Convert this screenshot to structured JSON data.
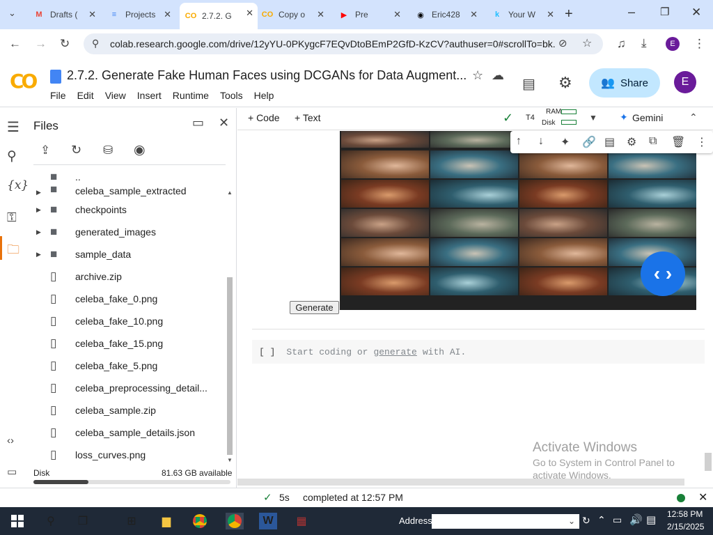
{
  "browser": {
    "tabs": [
      {
        "title": "Drafts (",
        "favicon": "gmail-icon",
        "fav_color": "#ea4335",
        "fav_glyph": "M"
      },
      {
        "title": "Projects",
        "favicon": "docs-icon",
        "fav_color": "#4285f4",
        "fav_glyph": "≡"
      },
      {
        "title": "2.7.2. G",
        "favicon": "colab-icon",
        "fav_color": "#f9ab00",
        "fav_glyph": "CO"
      },
      {
        "title": "Copy o",
        "favicon": "colab-icon",
        "fav_color": "#f9ab00",
        "fav_glyph": "CO"
      },
      {
        "title": "Pre",
        "favicon": "youtube-icon",
        "fav_color": "#ff0000",
        "fav_glyph": "▶"
      },
      {
        "title": "Eric428",
        "favicon": "github-icon",
        "fav_color": "#000000",
        "fav_glyph": "◉"
      },
      {
        "title": "Your W",
        "favicon": "kaggle-icon",
        "fav_color": "#20beff",
        "fav_glyph": "k"
      }
    ],
    "url": "colab.research.google.com/drive/12yYU-0PKygcF7EQvDtoBEmP2GfD-KzCV?authuser=0#scrollTo=bk...",
    "profile_initial": "E"
  },
  "colab": {
    "logo": "CO",
    "title": "2.7.2. Generate Fake Human Faces using DCGANs for Data Augment...",
    "menu": [
      "File",
      "Edit",
      "View",
      "Insert",
      "Runtime",
      "Tools",
      "Help"
    ],
    "share_label": "Share",
    "avatar_initial": "E",
    "toolbar": {
      "code_label": "+ Code",
      "text_label": "+ Text",
      "runtime_type": "T4",
      "ram_label": "RAM",
      "disk_label": "Disk",
      "gemini_label": "Gemini"
    }
  },
  "files_panel": {
    "title": "Files",
    "items": [
      {
        "name": "..",
        "type": "folder",
        "expandable": false
      },
      {
        "name": "celeba_sample_extracted",
        "type": "folder",
        "expandable": true
      },
      {
        "name": "checkpoints",
        "type": "folder",
        "expandable": true
      },
      {
        "name": "generated_images",
        "type": "folder",
        "expandable": true
      },
      {
        "name": "sample_data",
        "type": "folder",
        "expandable": true
      },
      {
        "name": "archive.zip",
        "type": "file",
        "expandable": false
      },
      {
        "name": "celeba_fake_0.png",
        "type": "file",
        "expandable": false
      },
      {
        "name": "celeba_fake_10.png",
        "type": "file",
        "expandable": false
      },
      {
        "name": "celeba_fake_15.png",
        "type": "file",
        "expandable": false
      },
      {
        "name": "celeba_fake_5.png",
        "type": "file",
        "expandable": false
      },
      {
        "name": "celeba_preprocessing_detail...",
        "type": "file",
        "expandable": false
      },
      {
        "name": "celeba_sample.zip",
        "type": "file",
        "expandable": false
      },
      {
        "name": "celeba_sample_details.json",
        "type": "file",
        "expandable": false
      },
      {
        "name": "loss_curves.png",
        "type": "file",
        "expandable": false
      }
    ],
    "disk_label": "Disk",
    "disk_available": "81.63 GB available",
    "disk_used_fraction": 0.28
  },
  "notebook": {
    "generate_button": "Generate",
    "empty_cell_prompt": "[ ]",
    "empty_cell_text_1": "Start coding or",
    "empty_cell_link": "generate",
    "empty_cell_text_2": "with AI."
  },
  "watermark": {
    "line1": "Activate Windows",
    "line2": "Go to System in Control Panel to",
    "line3": "activate Windows."
  },
  "status": {
    "duration": "5s",
    "completed": "completed at 12:57 PM"
  },
  "taskbar": {
    "address_label": "Address",
    "time": "12:58 PM",
    "date": "2/15/2025"
  }
}
